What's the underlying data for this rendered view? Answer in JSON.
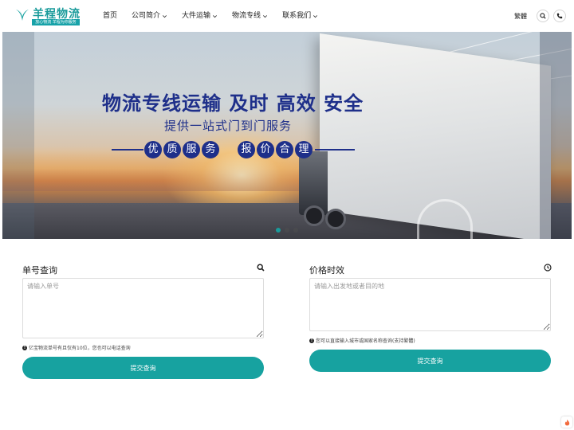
{
  "logo": {
    "title": "羊程物流",
    "subtitle": "放心物流 羊程为你服务"
  },
  "nav": {
    "items": [
      {
        "label": "首页"
      },
      {
        "label": "公司简介"
      },
      {
        "label": "大件运输"
      },
      {
        "label": "物流专线"
      },
      {
        "label": "联系我们"
      }
    ]
  },
  "header": {
    "lang_label": "繁體",
    "icons": [
      "search-icon",
      "phone-icon"
    ]
  },
  "banner": {
    "title": "物流专线运输  及时  高效  安全",
    "subtitle": "提供一站式门到门服务",
    "tags_left": [
      "优",
      "质",
      "服",
      "务"
    ],
    "tags_right": [
      "报",
      "价",
      "合",
      "理"
    ],
    "slides": 3,
    "active_slide": 1
  },
  "tracking": {
    "title": "单号查询",
    "icon": "search-icon",
    "placeholder": "请输入单号",
    "value": "",
    "note": "亿宝物流单号有且仅有10位，您也可以电话查询",
    "submit_label": "提交查询"
  },
  "pricing": {
    "title": "价格时效",
    "icon": "clock-icon",
    "placeholder": "请输入出发地或者目的地",
    "value": "",
    "note": "您可以直接输入城市或国家名称查询(支持繁體)",
    "submit_label": "提交查询"
  },
  "colors": {
    "brand": "#17a2a0",
    "banner_text": "#1e2f8a"
  }
}
